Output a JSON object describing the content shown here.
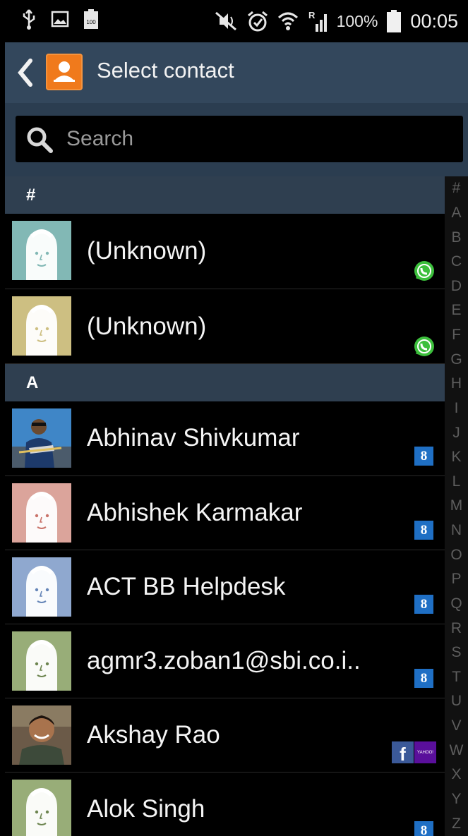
{
  "status_bar": {
    "battery_percent": "100%",
    "battery_small": "100",
    "time": "00:05",
    "signal_label": "R"
  },
  "action_bar": {
    "title": "Select contact"
  },
  "search": {
    "placeholder": "Search"
  },
  "sections": [
    {
      "header": "#",
      "contacts": [
        {
          "name": "(Unknown)",
          "avatar": "default-avatar-teal",
          "account": "whatsapp"
        },
        {
          "name": "(Unknown)",
          "avatar": "default-avatar-olive",
          "account": "whatsapp"
        }
      ]
    },
    {
      "header": "A",
      "contacts": [
        {
          "name": "Abhinav Shivkumar",
          "avatar": "photo",
          "account": "google"
        },
        {
          "name": "Abhishek Karmakar",
          "avatar": "default-avatar-pink",
          "account": "google"
        },
        {
          "name": "ACT BB Helpdesk",
          "avatar": "default-avatar-blue",
          "account": "google"
        },
        {
          "name": "agmr3.zoban1@sbi.co.i..",
          "avatar": "default-avatar-green",
          "account": "google"
        },
        {
          "name": "Akshay Rao",
          "avatar": "photo",
          "account": "facebook+yahoo"
        },
        {
          "name": "Alok Singh",
          "avatar": "default-avatar-green",
          "account": "google"
        }
      ]
    }
  ],
  "badges": {
    "google": "8",
    "facebook": "f",
    "yahoo": "YAHOO!"
  },
  "index_letters": [
    "#",
    "A",
    "B",
    "C",
    "D",
    "E",
    "F",
    "G",
    "H",
    "I",
    "J",
    "K",
    "L",
    "M",
    "N",
    "O",
    "P",
    "Q",
    "R",
    "S",
    "T",
    "U",
    "V",
    "W",
    "X",
    "Y",
    "Z"
  ],
  "colors": {
    "action_bar": "#33475c",
    "section_header": "#2f3f50",
    "accent_orange": "#f07a1c",
    "google_blue": "#1f6fc4",
    "whatsapp_green": "#3cbf3c"
  }
}
